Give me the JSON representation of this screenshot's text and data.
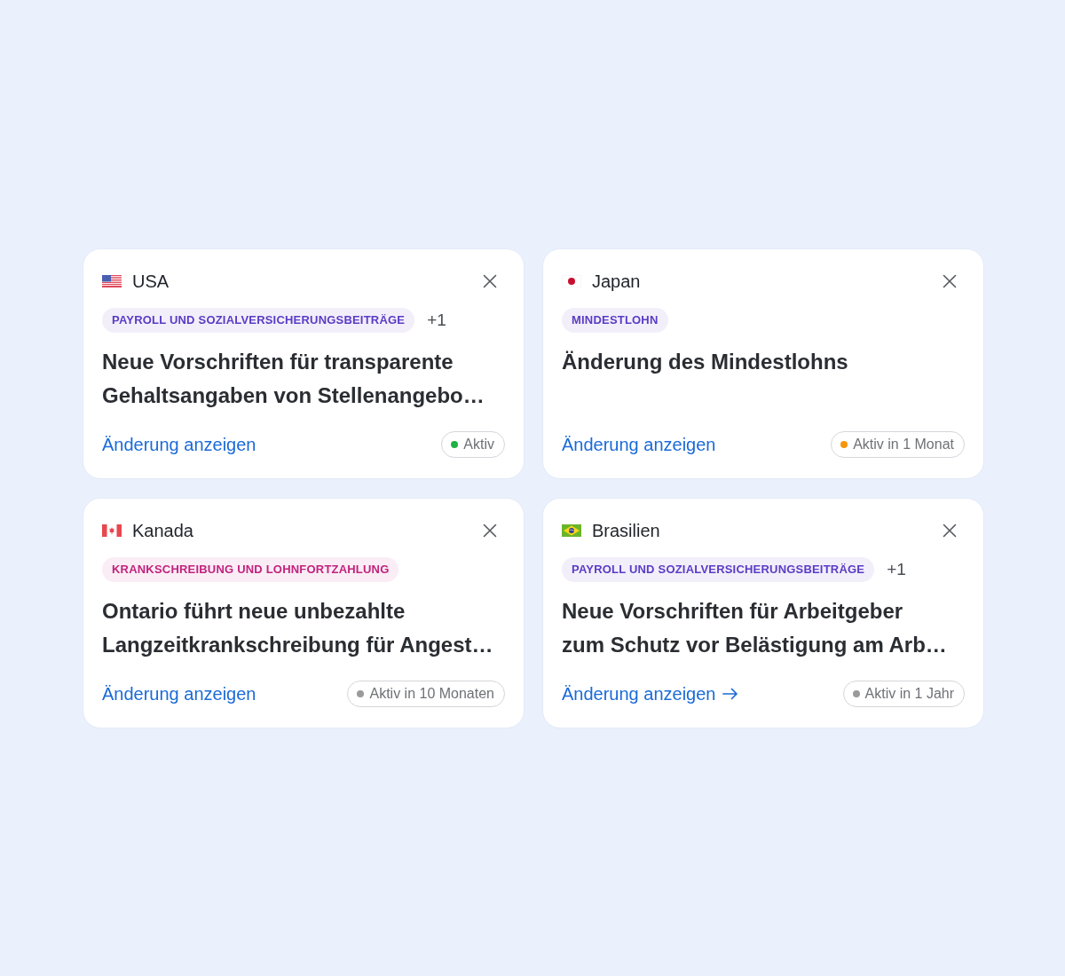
{
  "cards": [
    {
      "flag": {
        "kind": "us"
      },
      "country": "USA",
      "tags": [
        {
          "label": "PAYROLL UND SOZIALVERSICHERUNGSBEITRÄGE",
          "color": "#5a3bc6"
        }
      ],
      "more": "+1",
      "title": "Neue Vorschriften für transparente\nGehaltsangaben von Stellenangebo…",
      "link": {
        "label": "Änderung anzeigen",
        "arrow": false
      },
      "status": {
        "label": "Aktiv",
        "color": "#1fb141"
      }
    },
    {
      "flag": {
        "kind": "jp"
      },
      "country": "Japan",
      "tags": [
        {
          "label": "MINDESTLOHN",
          "color": "#5a3bc6"
        }
      ],
      "title": "Änderung des Mindestlohns",
      "link": {
        "label": "Änderung anzeigen",
        "arrow": false
      },
      "status": {
        "label": "Aktiv in 1 Monat",
        "color": "#f5960c"
      }
    },
    {
      "flag": {
        "kind": "ca"
      },
      "country": "Kanada",
      "tags": [
        {
          "label": "KRANKSCHREIBUNG UND LOHNFORTZAHLUNG",
          "color": "#c2227e"
        }
      ],
      "title": "Ontario führt neue unbezahlte\nLangzeitkrankschreibung für Angest…",
      "link": {
        "label": "Änderung anzeigen",
        "arrow": false
      },
      "status": {
        "label": "Aktiv in 10 Monaten",
        "color": "#9a9a9a"
      }
    },
    {
      "flag": {
        "kind": "br"
      },
      "country": "Brasilien",
      "tags": [
        {
          "label": "PAYROLL UND SOZIALVERSICHERUNGSBEITRÄGE",
          "color": "#5a3bc6"
        }
      ],
      "more": "+1",
      "title": "Neue Vorschriften für Arbeitgeber\nzum Schutz vor Belästigung am Arb…",
      "link": {
        "label": "Änderung anzeigen",
        "arrow": true
      },
      "status": {
        "label": "Aktiv in 1 Jahr",
        "color": "#9a9a9a"
      }
    }
  ]
}
